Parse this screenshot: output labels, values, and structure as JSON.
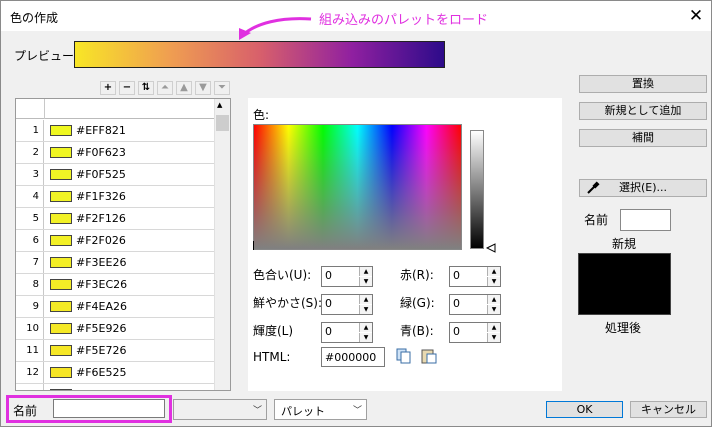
{
  "window": {
    "title": "色の作成",
    "close_glyph": "✕"
  },
  "annotation": {
    "text": "組み込みのパレットをロード",
    "color": "#e030e0"
  },
  "preview": {
    "label": "プレビュー",
    "gradient": [
      "#f8e626",
      "#f0a050",
      "#d8606b",
      "#9020a0",
      "#2d0b8a"
    ]
  },
  "toolbar": {
    "add": "+",
    "remove": "−",
    "swap": "⇅",
    "top": "⏶",
    "up": "▲",
    "down": "▼",
    "bottom": "⏷"
  },
  "rows": [
    {
      "n": "1",
      "hex": "#EFF821"
    },
    {
      "n": "2",
      "hex": "#F0F623"
    },
    {
      "n": "3",
      "hex": "#F0F525"
    },
    {
      "n": "4",
      "hex": "#F1F326"
    },
    {
      "n": "5",
      "hex": "#F2F126"
    },
    {
      "n": "6",
      "hex": "#F2F026"
    },
    {
      "n": "7",
      "hex": "#F3EE26"
    },
    {
      "n": "8",
      "hex": "#F3EC26"
    },
    {
      "n": "9",
      "hex": "#F4EA26"
    },
    {
      "n": "10",
      "hex": "#F5E926"
    },
    {
      "n": "11",
      "hex": "#F5E726"
    },
    {
      "n": "12",
      "hex": "#F6E525"
    },
    {
      "n": "13",
      "hex": "#F7E425"
    }
  ],
  "picker": {
    "color_label": "色:",
    "hue": {
      "label": "色合い(U):",
      "value": "0"
    },
    "sat": {
      "label": "鮮やかさ(S):",
      "value": "0"
    },
    "lum": {
      "label": "輝度(L)",
      "value": "0"
    },
    "red": {
      "label": "赤(R):",
      "value": "0"
    },
    "green": {
      "label": "緑(G):",
      "value": "0"
    },
    "blue": {
      "label": "青(B):",
      "value": "0"
    },
    "html_label": "HTML:",
    "html_value": "#000000"
  },
  "right": {
    "replace": "置換",
    "add_new": "新規として追加",
    "interpolate": "補間",
    "select": "選択(E)...",
    "name_label": "名前",
    "new_label": "新規",
    "after_label": "処理後",
    "after_color": "#000000"
  },
  "bottom": {
    "name_label": "名前",
    "name_value": "",
    "combo1_value": "",
    "palette": "パレット",
    "ok": "OK",
    "cancel": "キャンセル"
  }
}
